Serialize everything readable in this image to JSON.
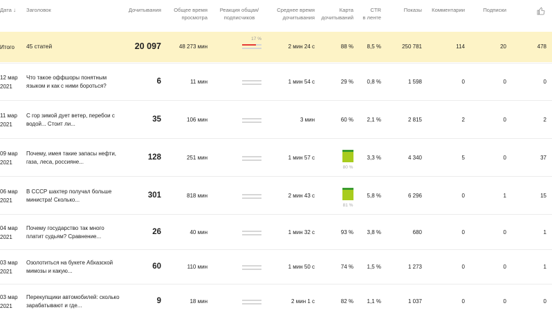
{
  "header": {
    "date": "Дата",
    "title": "Заголовок",
    "reads": "Дочитывания",
    "total_time_1": "Общее время",
    "total_time_2": "просмотра",
    "reaction_1": "Реакция общая/",
    "reaction_2": "подписчиков",
    "avg_time_1": "Среднее время",
    "avg_time_2": "дочитывания",
    "heatmap_1": "Карта",
    "heatmap_2": "дочитываний",
    "ctr_1": "CTR",
    "ctr_2": "в ленте",
    "impressions": "Показы",
    "comments": "Комментарии",
    "subscriptions": "Подписки",
    "likes_icon": "thumbs-up-icon"
  },
  "total": {
    "date": "Итого",
    "title": "45 статей",
    "reads": "20 097",
    "total_time": "48 273 мин",
    "reaction_pct": "17 %",
    "reaction_fill": 0.72,
    "reaction_fill_color": "#e53935",
    "avg_time": "2 мин 24 с",
    "heat": "88 %",
    "ctr": "8,5 %",
    "impressions": "250 781",
    "comments": "114",
    "subscriptions": "20",
    "likes": "478"
  },
  "rows": [
    {
      "date1": "12 мар",
      "date2": "2021",
      "title": "Что такое оффшоры понятным языком и как с ними бороться?",
      "reads": "6",
      "total_time": "11 мин",
      "avg_time": "1 мин 54 с",
      "heat": "29 %",
      "ctr": "0,8 %",
      "impressions": "1 598",
      "comments": "0",
      "subscriptions": "0",
      "likes": "0"
    },
    {
      "date1": "11 мар",
      "date2": "2021",
      "title": "С гор зимой дует ветер, перебои с водой... Стоит ли...",
      "reads": "35",
      "total_time": "106 мин",
      "avg_time": "3 мин",
      "heat": "60 %",
      "ctr": "2,1 %",
      "impressions": "2 815",
      "comments": "2",
      "subscriptions": "0",
      "likes": "2"
    },
    {
      "date1": "09 мар",
      "date2": "2021",
      "title": "Почему, имея такие запасы нефти, газа, леса, россияне...",
      "reads": "128",
      "total_time": "251 мин",
      "avg_time": "1 мин 57 с",
      "heat": "80 %",
      "ctr": "3,3 %",
      "impressions": "4 340",
      "comments": "5",
      "subscriptions": "0",
      "likes": "37"
    },
    {
      "date1": "06 мар",
      "date2": "2021",
      "title": "В СССР шахтер получал больше министра! Сколько...",
      "reads": "301",
      "total_time": "818 мин",
      "avg_time": "2 мин 43 с",
      "heat": "81 %",
      "ctr": "5,8 %",
      "impressions": "6 296",
      "comments": "0",
      "subscriptions": "1",
      "likes": "15"
    },
    {
      "date1": "04 мар",
      "date2": "2021",
      "title": "Почему государство так много платит судьям? Сравнение...",
      "reads": "26",
      "total_time": "40 мин",
      "avg_time": "1 мин 32 с",
      "heat": "93 %",
      "ctr": "3,8 %",
      "impressions": "680",
      "comments": "0",
      "subscriptions": "0",
      "likes": "1"
    },
    {
      "date1": "03 мар",
      "date2": "2021",
      "title": "Озолотиться на букете Абхазской мимозы и какую...",
      "reads": "60",
      "total_time": "110 мин",
      "avg_time": "1 мин 50 с",
      "heat": "74 %",
      "ctr": "1,5 %",
      "impressions": "1 273",
      "comments": "0",
      "subscriptions": "0",
      "likes": "1"
    },
    {
      "date1": "03 мар",
      "date2": "2021",
      "title": "Перекупщики автомобилей: сколько зарабатывают и где...",
      "reads": "9",
      "total_time": "18 мин",
      "avg_time": "2 мин 1 с",
      "heat": "82 %",
      "ctr": "1,1 %",
      "impressions": "1 037",
      "comments": "0",
      "subscriptions": "0",
      "likes": "0"
    }
  ]
}
